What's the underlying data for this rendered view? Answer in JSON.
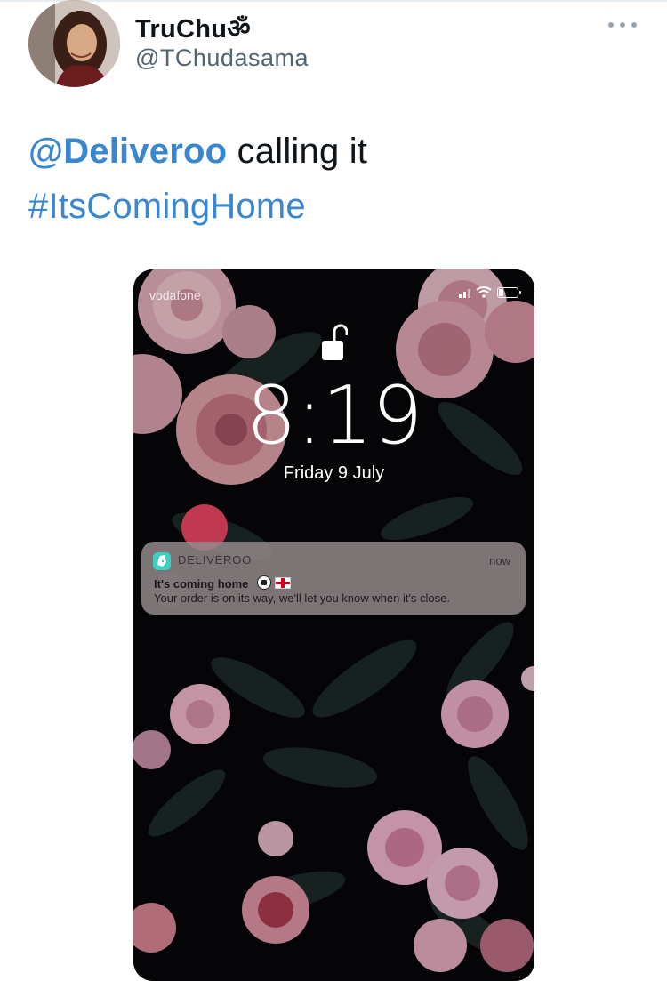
{
  "tweet": {
    "display_name": "TruChuॐ",
    "handle": "@TChudasama",
    "more_icon": "more-horizontal-icon",
    "text": {
      "mention": "@Deliveroo",
      "rest": " calling it",
      "hashtag": "#ItsComingHome"
    },
    "link_color": "#3a87cf"
  },
  "phone_screen": {
    "carrier": "vodafone",
    "time": "8:19",
    "date": "Friday 9 July",
    "lock_icon": "unlocked-padlock-icon",
    "notification": {
      "app_name": "DELIVEROO",
      "app_icon": "deliveroo-logo-icon",
      "time": "now",
      "title": "It's coming home",
      "emoji": [
        "soccer-ball-icon",
        "england-flag-icon"
      ],
      "body": "Your order is on its way, we'll let you know when it's close.",
      "app_color": "#3ecdc1"
    }
  }
}
